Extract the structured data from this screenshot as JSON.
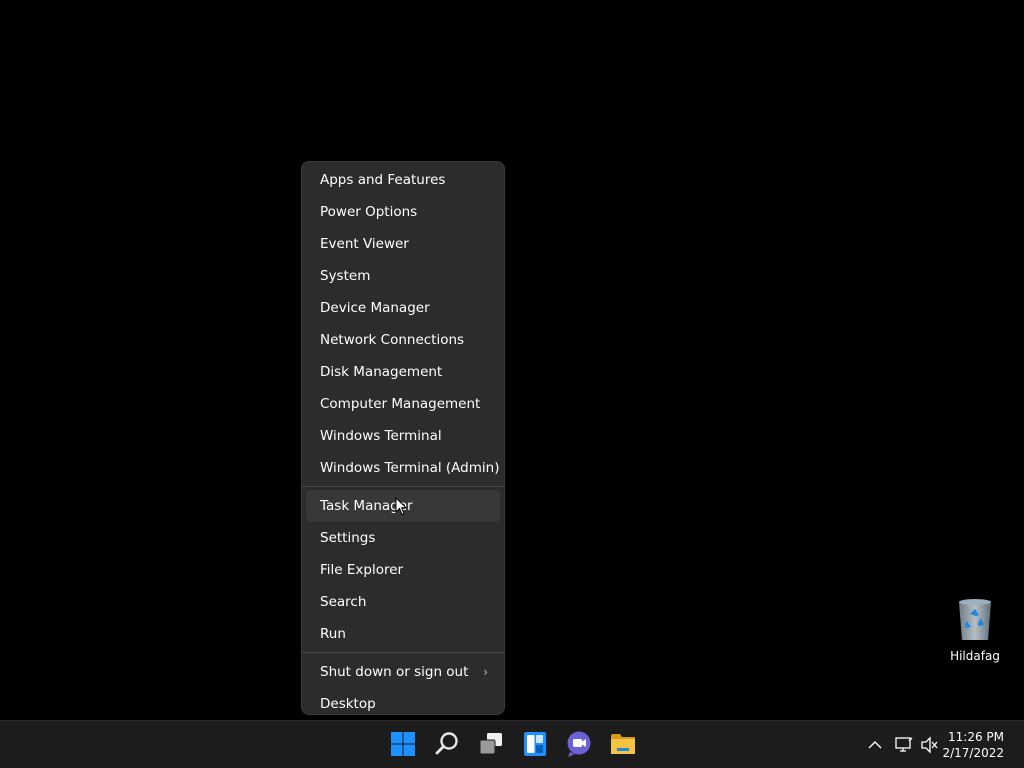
{
  "context_menu": {
    "group1": [
      {
        "label": "Apps and Features"
      },
      {
        "label": "Power Options"
      },
      {
        "label": "Event Viewer"
      },
      {
        "label": "System"
      },
      {
        "label": "Device Manager"
      },
      {
        "label": "Network Connections"
      },
      {
        "label": "Disk Management"
      },
      {
        "label": "Computer Management"
      },
      {
        "label": "Windows Terminal"
      },
      {
        "label": "Windows Terminal (Admin)"
      }
    ],
    "group2": [
      {
        "label": "Task Manager",
        "hovered": true
      },
      {
        "label": "Settings"
      },
      {
        "label": "File Explorer"
      },
      {
        "label": "Search"
      },
      {
        "label": "Run"
      }
    ],
    "group3": [
      {
        "label": "Shut down or sign out",
        "submenu_icon": "chevron-right-icon"
      },
      {
        "label": "Desktop"
      }
    ]
  },
  "desktop": {
    "icons": [
      {
        "label": "Hildafag",
        "icon": "recycle-bin-icon"
      }
    ]
  },
  "taskbar": {
    "apps": [
      {
        "name": "start",
        "icon": "windows-start-icon"
      },
      {
        "name": "search",
        "icon": "search-icon"
      },
      {
        "name": "task-view",
        "icon": "task-view-icon"
      },
      {
        "name": "widgets",
        "icon": "widgets-icon"
      },
      {
        "name": "chat",
        "icon": "teams-chat-icon"
      },
      {
        "name": "file-explorer",
        "icon": "folder-icon"
      }
    ],
    "tray": {
      "icons": [
        "chevron-up-icon",
        "network-icon",
        "volume-muted-icon"
      ],
      "time": "11:26 PM",
      "date": "2/17/2022"
    }
  },
  "colors": {
    "accent": "#0078d4",
    "menu_bg": "#2c2c2c",
    "taskbar_bg": "#1c1c1c",
    "folder": "#f4c542"
  }
}
